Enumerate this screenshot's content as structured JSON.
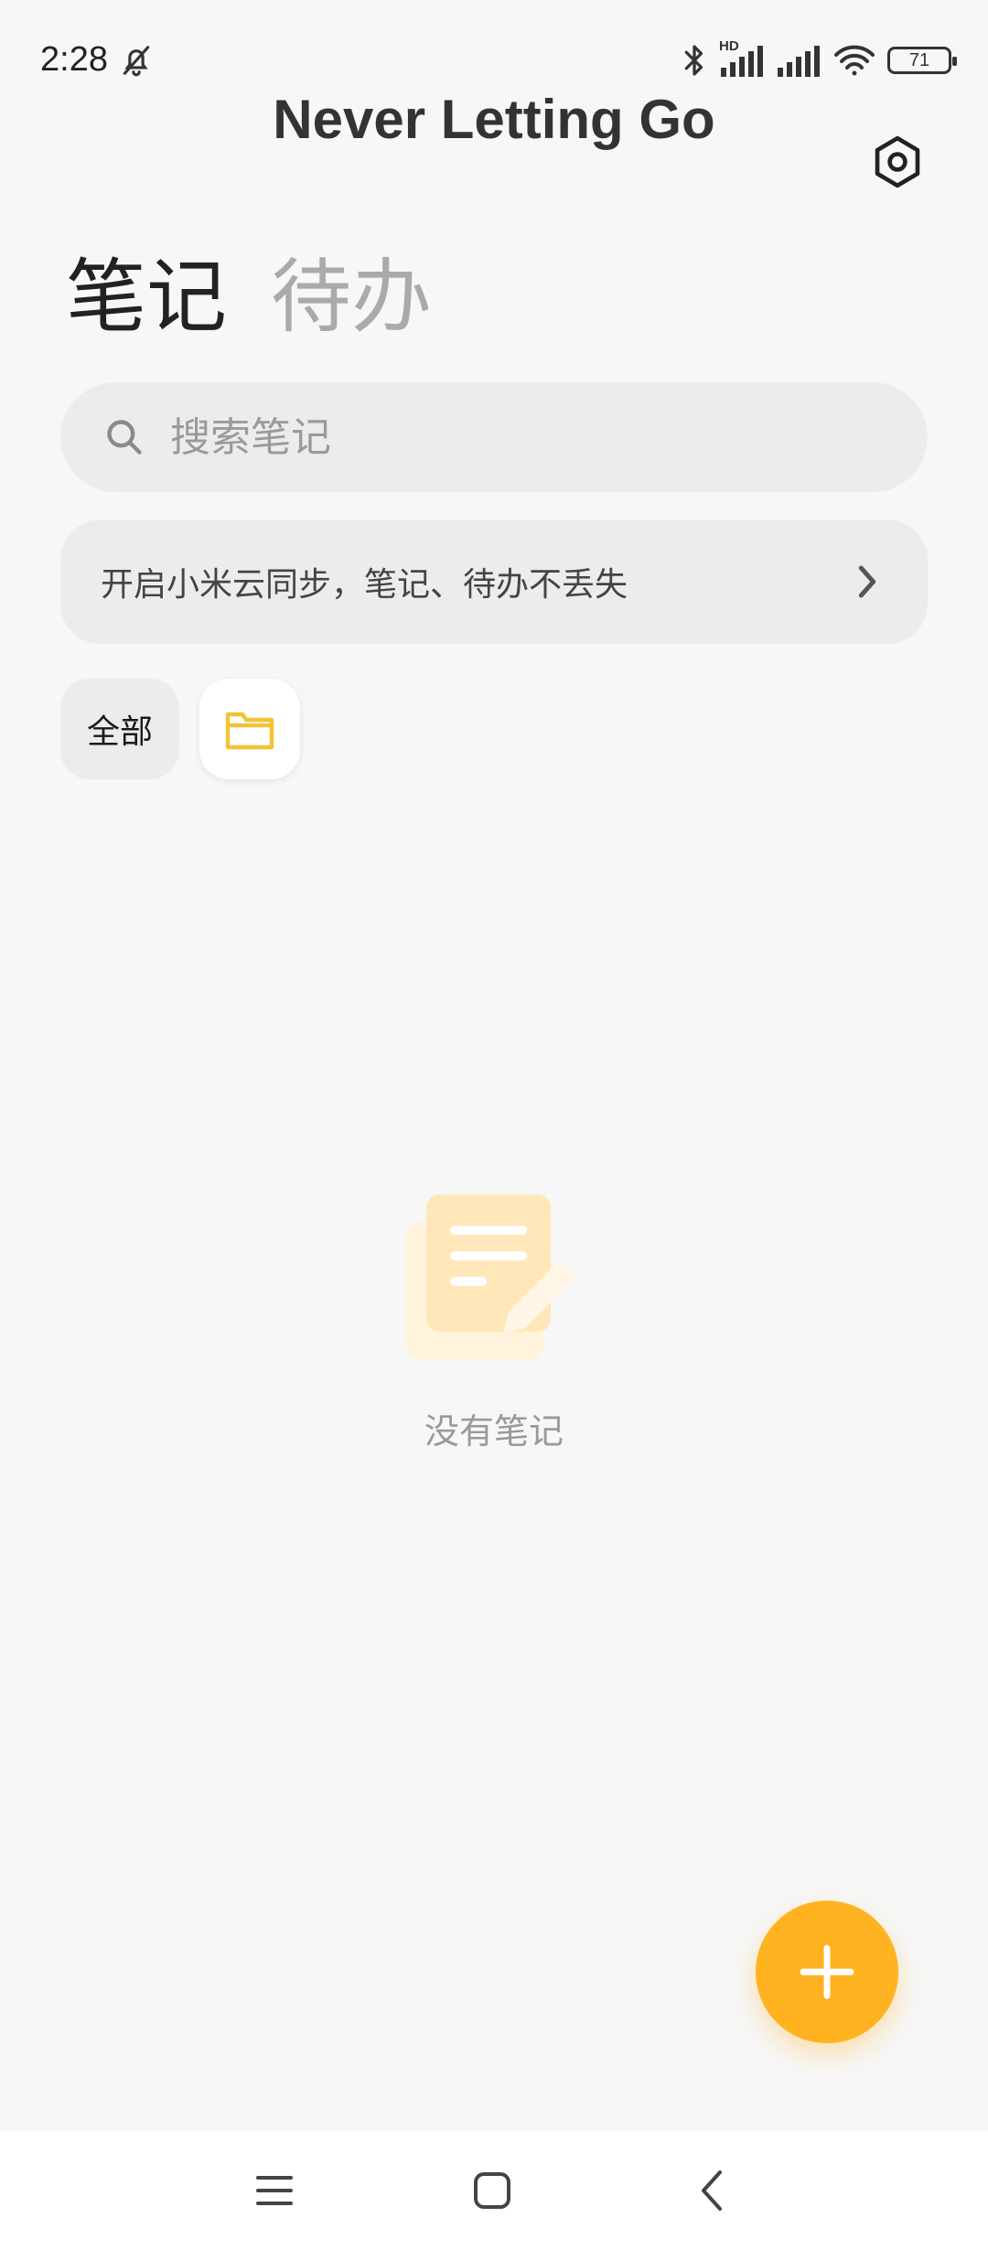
{
  "status_bar": {
    "time": "2:28",
    "network_label": "HD",
    "battery_level": "71",
    "icons": [
      "bell-off-icon",
      "bluetooth-icon",
      "signal-icon",
      "signal-icon",
      "wifi-icon",
      "battery-icon"
    ]
  },
  "header": {
    "title": "Never Letting Go",
    "settings_icon": "settings-hex-icon"
  },
  "tabs": [
    {
      "label": "笔记",
      "active": true
    },
    {
      "label": "待办",
      "active": false
    }
  ],
  "search": {
    "placeholder": "搜索笔记",
    "value": ""
  },
  "sync_banner": {
    "text": "开启小米云同步，笔记、待办不丢失"
  },
  "folders": {
    "all_label": "全部",
    "folder_icon": "folder-icon"
  },
  "empty_state": {
    "text": "没有笔记",
    "icon": "note-pencil-icon"
  },
  "fab": {
    "icon": "plus-icon"
  },
  "colors": {
    "accent": "#ffb320",
    "folder_icon": "#f5c234",
    "background": "#f7f7f7",
    "surface": "#ececec"
  }
}
